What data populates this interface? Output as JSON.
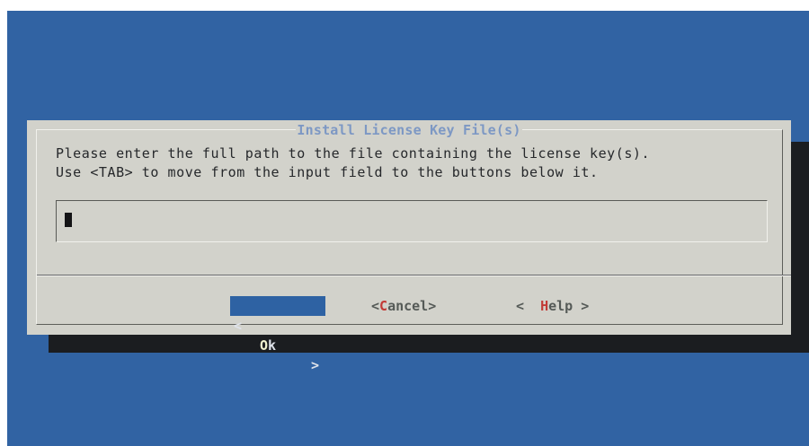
{
  "dialog": {
    "title": "Install License Key File(s)",
    "prompt_line1": "Please enter the full path to the file containing the license key(s).",
    "prompt_line2": "Use <TAB> to move from the input field to the buttons below it.",
    "input": {
      "value": "",
      "placeholder": ""
    },
    "buttons": {
      "ok": {
        "left": "<",
        "hotkey": "O",
        "rest": "k",
        "right": ">"
      },
      "cancel": {
        "left": "<",
        "hotkey": "C",
        "rest": "ancel",
        "right": ">"
      },
      "help": {
        "left": "<",
        "hotkey": "H",
        "rest": "elp",
        "right": ">"
      }
    }
  },
  "colors": {
    "background": "#3163a3",
    "dialog": "#d2d2cb",
    "title": "#7d98c4",
    "selected_button": "#2e62a3",
    "hotkey": "#c23a36"
  }
}
